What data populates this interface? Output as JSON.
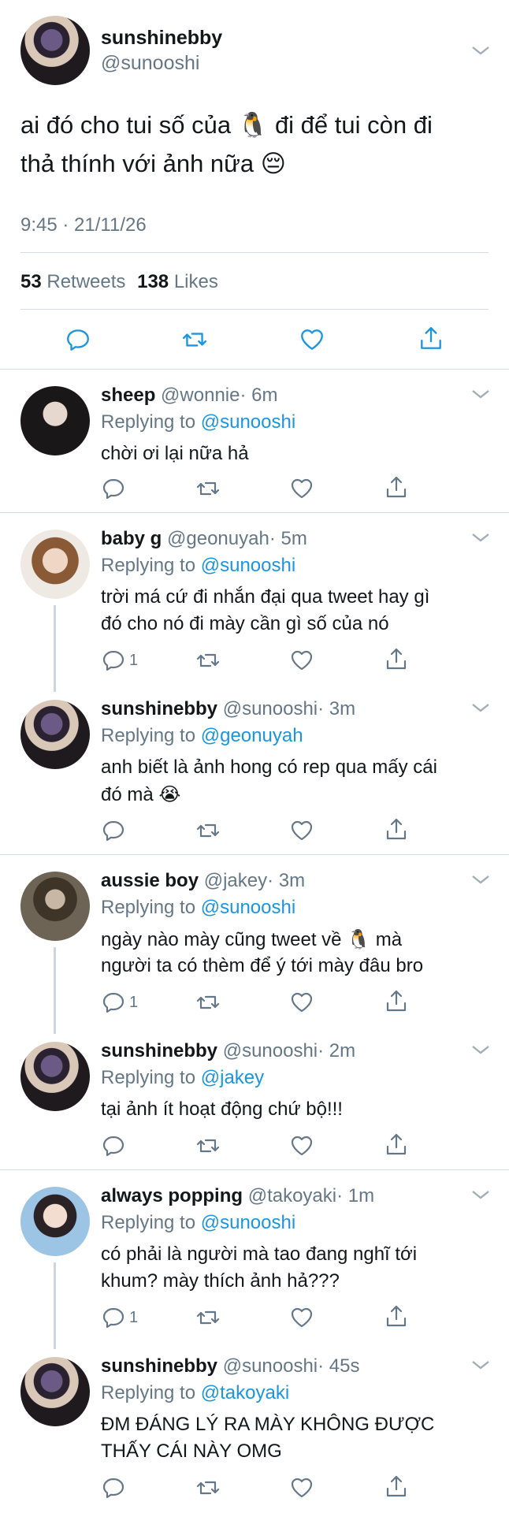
{
  "main_tweet": {
    "display_name": "sunshinebby",
    "handle": "@sunooshi",
    "text_line1": "ai đó cho tui số của 🐧 đi để tui còn đi",
    "text_line2": "thả thính với ảnh nữa 😔",
    "timestamp": "9:45 · 21/11/26",
    "retweets_count": "53",
    "retweets_label": "Retweets",
    "likes_count": "138",
    "likes_label": "Likes"
  },
  "replying_label": "Replying to",
  "replies": [
    {
      "display_name": "sheep",
      "handle": "@wonnie",
      "time": "· 6m",
      "replying_to": "@sunooshi",
      "lines": [
        "chời ơi lại nữa hả"
      ],
      "reply_count": ""
    },
    {
      "display_name": "baby g",
      "handle": "@geonuyah",
      "time": "· 5m",
      "replying_to": "@sunooshi",
      "lines": [
        "trời má cứ đi nhắn đại qua tweet hay gì",
        "đó cho nó đi mày cần gì số của nó"
      ],
      "reply_count": "1"
    },
    {
      "display_name": "sunshinebby",
      "handle": "@sunooshi",
      "time": "· 3m",
      "replying_to": "@geonuyah",
      "lines": [
        "anh biết là ảnh hong có rep qua mấy cái",
        "đó mà 😭"
      ],
      "reply_count": ""
    },
    {
      "display_name": "aussie boy",
      "handle": "@jakey",
      "time": "· 3m",
      "replying_to": "@sunooshi",
      "lines": [
        "ngày nào mày cũng tweet về 🐧 mà",
        "người ta có thèm để ý tới mày đâu bro"
      ],
      "reply_count": "1"
    },
    {
      "display_name": "sunshinebby",
      "handle": "@sunooshi",
      "time": "· 2m",
      "replying_to": "@jakey",
      "lines": [
        "tại ảnh ít hoạt động chứ bộ!!!"
      ],
      "reply_count": ""
    },
    {
      "display_name": "always popping",
      "handle": "@takoyaki",
      "time": "· 1m",
      "replying_to": "@sunooshi",
      "lines": [
        "có phải là người mà tao đang nghĩ tới",
        "khum? mày thích ảnh hả???"
      ],
      "reply_count": "1"
    },
    {
      "display_name": "sunshinebby",
      "handle": "@sunooshi",
      "time": "· 45s",
      "replying_to": "@takoyaki",
      "lines": [
        "ĐM ĐÁNG LÝ RA MÀY KHÔNG ĐƯỢC",
        "THẤY CÁI NÀY OMG"
      ],
      "reply_count": ""
    }
  ],
  "colors": {
    "link_blue": "#1b95e0",
    "secondary_grey": "#657786",
    "divider": "#d5dbe0"
  },
  "icons": [
    "reply-icon",
    "retweet-icon",
    "like-icon",
    "share-icon",
    "chevron-down-icon"
  ]
}
